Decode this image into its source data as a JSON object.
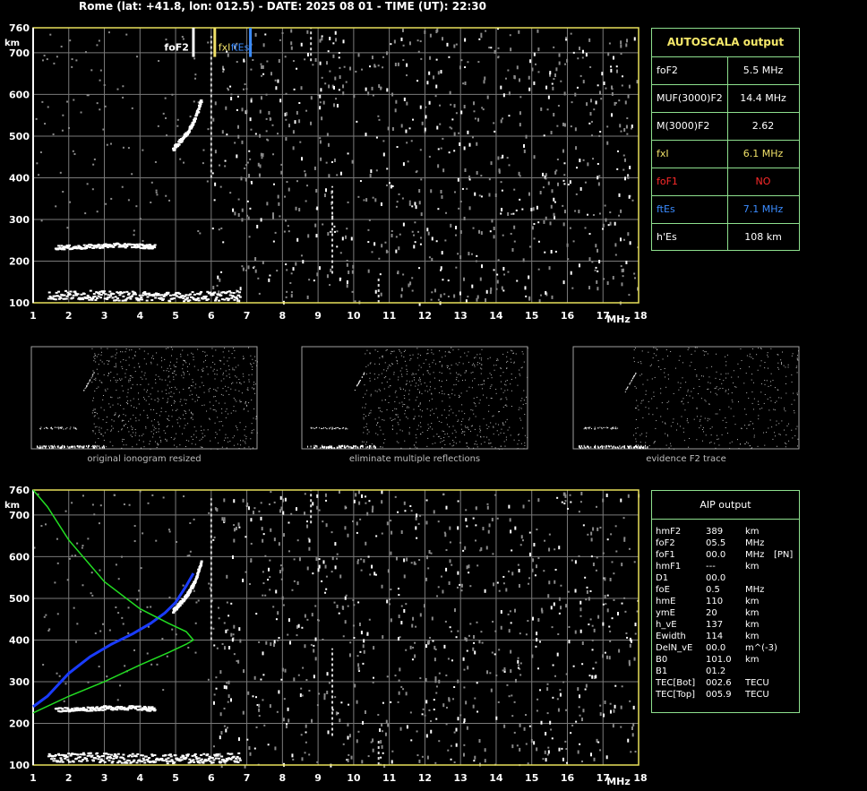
{
  "header": "Rome (lat: +41.8, lon: 012.5) - DATE: 2025 08 01 - TIME (UT): 22:30",
  "axis": {
    "y_unit": "km",
    "x_unit": "MHz",
    "y_ticks": [
      "760",
      "700",
      "600",
      "500",
      "400",
      "300",
      "200",
      "100"
    ],
    "x_ticks": [
      "1",
      "2",
      "3",
      "4",
      "5",
      "6",
      "7",
      "8",
      "9",
      "10",
      "11",
      "12",
      "13",
      "14",
      "15",
      "16",
      "17",
      "18"
    ]
  },
  "markers": {
    "foF2": "foF2",
    "fxI": "fxI",
    "ftEs": "ftEs"
  },
  "autoscala": {
    "title": "AUTOSCALA output",
    "rows": [
      {
        "label": "foF2",
        "value": "5.5 MHz",
        "color": "#ffffff"
      },
      {
        "label": "MUF(3000)F2",
        "value": "14.4 MHz",
        "color": "#ffffff"
      },
      {
        "label": "M(3000)F2",
        "value": "2.62",
        "color": "#ffffff"
      },
      {
        "label": "fxI",
        "value": "6.1 MHz",
        "color": "#f0e068"
      },
      {
        "label": "foF1",
        "value": "NO",
        "color": "#ff2a2a"
      },
      {
        "label": "ftEs",
        "value": "7.1 MHz",
        "color": "#3b8cff"
      },
      {
        "label": "h'Es",
        "value": "108     km",
        "color": "#ffffff"
      }
    ]
  },
  "thumb_captions": [
    "original ionogram resized",
    "eliminate multiple reflections",
    "evidence F2 trace"
  ],
  "aip": {
    "title": "AIP output",
    "rows": [
      {
        "name": "hmF2",
        "value": "389",
        "unit": "km",
        "extra": ""
      },
      {
        "name": "foF2",
        "value": "05.5",
        "unit": "MHz",
        "extra": ""
      },
      {
        "name": "foF1",
        "value": "00.0",
        "unit": "MHz",
        "extra": "[PN]"
      },
      {
        "name": "hmF1",
        "value": "---",
        "unit": "km",
        "extra": ""
      },
      {
        "name": "D1",
        "value": "00.0",
        "unit": "",
        "extra": ""
      },
      {
        "name": "foE",
        "value": "0.5",
        "unit": "MHz",
        "extra": ""
      },
      {
        "name": "hmE",
        "value": "110",
        "unit": "km",
        "extra": ""
      },
      {
        "name": "ymE",
        "value": "20",
        "unit": "km",
        "extra": ""
      },
      {
        "name": "h_vE",
        "value": "137",
        "unit": "km",
        "extra": ""
      },
      {
        "name": "Ewidth",
        "value": "114",
        "unit": "km",
        "extra": ""
      },
      {
        "name": "DelN_vE",
        "value": "00.0",
        "unit": "m^(-3)",
        "extra": ""
      },
      {
        "name": "B0",
        "value": "101.0",
        "unit": "km",
        "extra": ""
      },
      {
        "name": "B1",
        "value": "01.2",
        "unit": "",
        "extra": ""
      },
      {
        "name": "TEC[Bot]",
        "value": "002.6",
        "unit": "TECU",
        "extra": ""
      },
      {
        "name": "TEC[Top]",
        "value": "005.9",
        "unit": "TECU",
        "extra": ""
      }
    ]
  },
  "colors": {
    "frame": "#e8e05a",
    "grid": "#7a7a7a",
    "panel_border": "#8ee08e",
    "foF2_marker": "#ffffff",
    "fxI_marker": "#f0e068",
    "ftEs_marker": "#3b8cff",
    "profile_green": "#22dd22",
    "profile_blue": "#1a3cff"
  },
  "chart_data": [
    {
      "type": "scatter",
      "name": "ionogram",
      "xlabel": "MHz",
      "ylabel": "km",
      "xlim": [
        1,
        18
      ],
      "ylim": [
        100,
        760
      ],
      "grid": true,
      "traces": [
        {
          "layer": "Es",
          "x": [
            1.4,
            2.0,
            2.6,
            3.2,
            3.8,
            4.4,
            5.0,
            5.6,
            6.2,
            6.8
          ],
          "y": [
            120,
            120,
            120,
            118,
            118,
            118,
            116,
            118,
            118,
            120
          ]
        },
        {
          "layer": "F2 second hop",
          "x": [
            1.6,
            2.2,
            2.8,
            3.4,
            4.0,
            4.4
          ],
          "y": [
            235,
            235,
            238,
            240,
            238,
            236
          ]
        },
        {
          "layer": "F2",
          "x": [
            4.9,
            5.1,
            5.3,
            5.5,
            5.7
          ],
          "y": [
            470,
            490,
            510,
            540,
            590
          ]
        }
      ],
      "markers": [
        {
          "label": "foF2",
          "x": 5.5
        },
        {
          "label": "fxI",
          "x": 6.1
        },
        {
          "label": "ftEs",
          "x": 7.1
        }
      ]
    },
    {
      "type": "line",
      "name": "aip profile",
      "xlabel": "MHz",
      "ylabel": "km",
      "xlim": [
        1,
        18
      ],
      "ylim": [
        100,
        760
      ],
      "grid": true,
      "series": [
        {
          "color": "#1a3cff",
          "x": [
            1.0,
            1.4,
            2.0,
            2.6,
            3.2,
            3.8,
            4.3,
            4.7,
            5.0,
            5.3,
            5.5
          ],
          "y": [
            240,
            265,
            320,
            360,
            390,
            415,
            440,
            465,
            490,
            530,
            560
          ]
        },
        {
          "color": "#22dd22",
          "x": [
            1.0,
            2.0,
            3.0,
            4.0,
            4.8,
            5.3,
            5.5,
            5.3,
            4.8,
            4.0,
            3.0,
            2.0,
            1.4,
            1.0
          ],
          "y": [
            225,
            265,
            300,
            340,
            370,
            390,
            400,
            420,
            440,
            475,
            540,
            640,
            720,
            760
          ]
        }
      ]
    }
  ]
}
